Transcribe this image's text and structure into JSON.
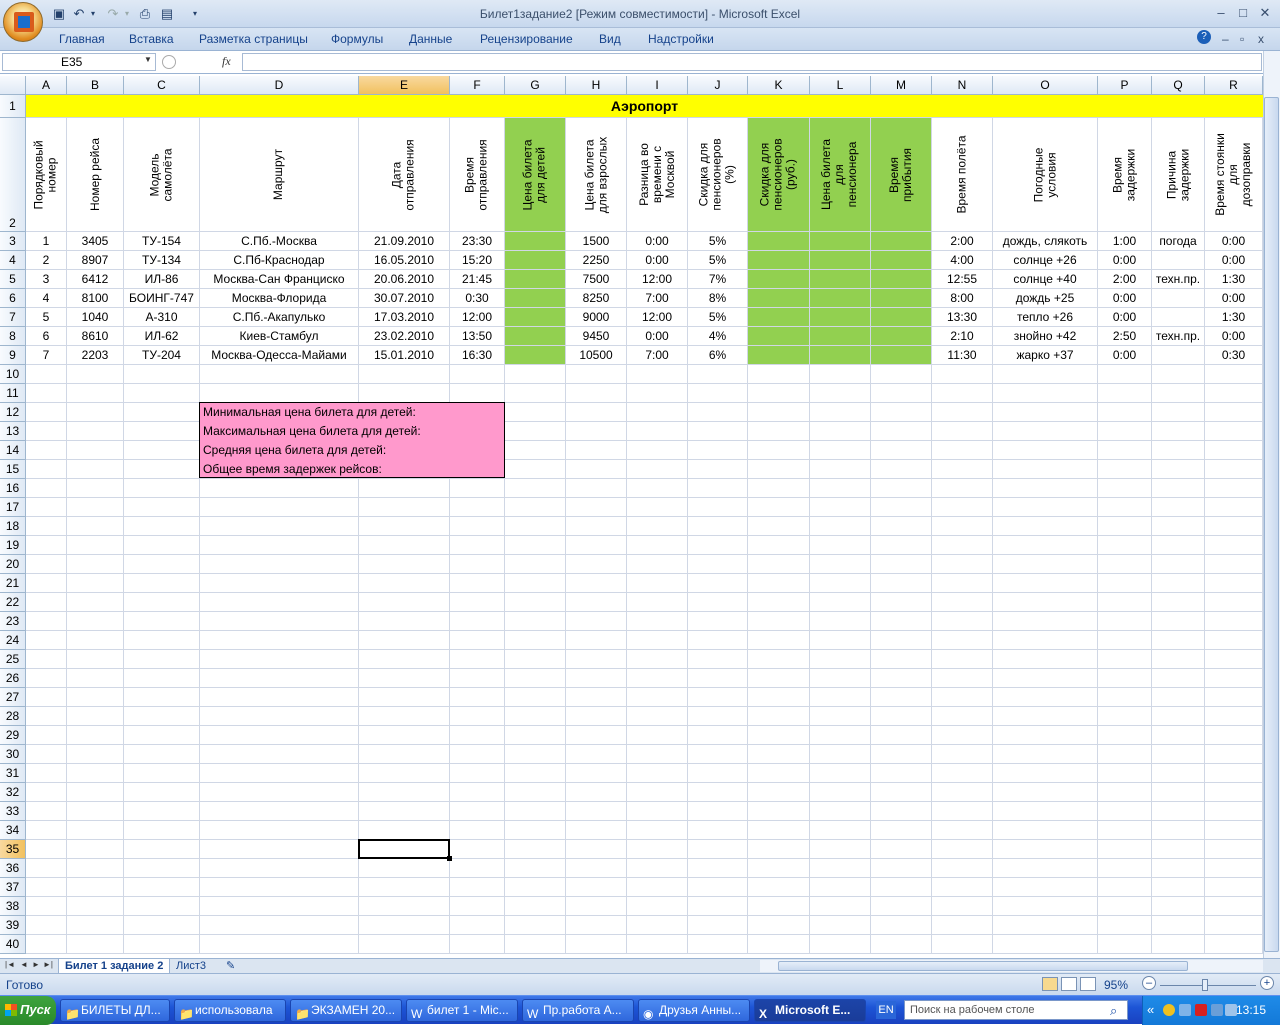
{
  "window": {
    "title": "Билет1задание2  [Режим совместимости] - Microsoft Excel",
    "controls": {
      "minimize": "–",
      "maximize": "□",
      "close": "✕"
    }
  },
  "ribbon": {
    "tabs": [
      "Главная",
      "Вставка",
      "Разметка страницы",
      "Формулы",
      "Данные",
      "Рецензирование",
      "Вид",
      "Надстройки"
    ]
  },
  "formula_bar": {
    "name_box": "E35",
    "fx": "fx",
    "value": ""
  },
  "columns": [
    "A",
    "B",
    "C",
    "D",
    "E",
    "F",
    "G",
    "H",
    "I",
    "J",
    "K",
    "L",
    "M",
    "N",
    "O",
    "P",
    "Q",
    "R"
  ],
  "rows": [
    "1",
    "2",
    "3",
    "4",
    "5",
    "6",
    "7",
    "8",
    "9",
    "10",
    "11",
    "12",
    "13",
    "14",
    "15",
    "16",
    "17",
    "18",
    "19",
    "20",
    "21",
    "22",
    "23",
    "24",
    "25",
    "26",
    "27",
    "28",
    "29",
    "30",
    "31",
    "32",
    "33",
    "34",
    "35",
    "36",
    "37",
    "38",
    "39",
    "40"
  ],
  "sheet_title": "Аэропорт",
  "headers": [
    "Порядковый\nномер",
    "Номер рейса",
    "Модель\nсамолёта",
    "Маршрут",
    "Дата\nотправления",
    "Время\nотправления",
    "Цена билета\nдля детей",
    "Цена билета\nдля взрослых",
    "Разница во\nвремени с\nМосквой",
    "Скидка для\nпенсионеров\n(%)",
    "Скидка для\nпенсионеров\n(руб.)",
    "Цена билета\nдля\nпенсионера",
    "Время\nприбытия",
    "Время полёта",
    "Погодные\nусловия",
    "Время\nзадержки",
    "Причина\nзадержки",
    "Время стоянки\nдля\nдозоправки"
  ],
  "table_rows": [
    [
      "1",
      "3405",
      "ТУ-154",
      "С.Пб.-Москва",
      "21.09.2010",
      "23:30",
      "",
      "1500",
      "0:00",
      "5%",
      "",
      "",
      "",
      "2:00",
      "дождь, слякоть",
      "1:00",
      "погода",
      "0:00"
    ],
    [
      "2",
      "8907",
      "ТУ-134",
      "С.Пб-Краснодар",
      "16.05.2010",
      "15:20",
      "",
      "2250",
      "0:00",
      "5%",
      "",
      "",
      "",
      "4:00",
      "солнце +26",
      "0:00",
      "",
      "0:00"
    ],
    [
      "3",
      "6412",
      "ИЛ-86",
      "Москва-Сан Франциско",
      "20.06.2010",
      "21:45",
      "",
      "7500",
      "12:00",
      "7%",
      "",
      "",
      "",
      "12:55",
      "солнце +40",
      "2:00",
      "техн.пр.",
      "1:30"
    ],
    [
      "4",
      "8100",
      "БОИНГ-747",
      "Москва-Флорида",
      "30.07.2010",
      "0:30",
      "",
      "8250",
      "7:00",
      "8%",
      "",
      "",
      "",
      "8:00",
      "дождь  +25",
      "0:00",
      "",
      "0:00"
    ],
    [
      "5",
      "1040",
      "А-310",
      "С.Пб.-Акапулько",
      "17.03.2010",
      "12:00",
      "",
      "9000",
      "12:00",
      "5%",
      "",
      "",
      "",
      "13:30",
      "тепло +26",
      "0:00",
      "",
      "1:30"
    ],
    [
      "6",
      "8610",
      "ИЛ-62",
      "Киев-Стамбул",
      "23.02.2010",
      "13:50",
      "",
      "9450",
      "0:00",
      "4%",
      "",
      "",
      "",
      "2:10",
      "знойно +42",
      "2:50",
      "техн.пр.",
      "0:00"
    ],
    [
      "7",
      "2203",
      "ТУ-204",
      "Москва-Одесса-Майами",
      "15.01.2010",
      "16:30",
      "",
      "10500",
      "7:00",
      "6%",
      "",
      "",
      "",
      "11:30",
      "жарко +37",
      "0:00",
      "",
      "0:30"
    ]
  ],
  "summary": [
    "Минимальная цена билета для детей:",
    "Максимальная цена билета для детей:",
    "Средняя цена билета для детей:",
    "Общее время задержек рейсов:"
  ],
  "sheet_tabs": [
    "Билет 1 задание 2",
    "Лист3"
  ],
  "status": {
    "ready": "Готово",
    "zoom": "95%"
  },
  "taskbar": {
    "start": "Пуск",
    "buttons": [
      "БИЛЕТЫ ДЛ...",
      "использовала",
      "ЭКЗАМЕН 20...",
      "билет 1 - Mic...",
      "Пр.работа А...",
      "Друзья Анны...",
      "Microsoft E..."
    ],
    "lang": "EN",
    "search_placeholder": "Поиск на рабочем столе",
    "clock": "13:15"
  },
  "colors": {
    "title_fill": "#ffff00",
    "green_fill": "#92d050",
    "pink_fill": "#ff99cc"
  }
}
